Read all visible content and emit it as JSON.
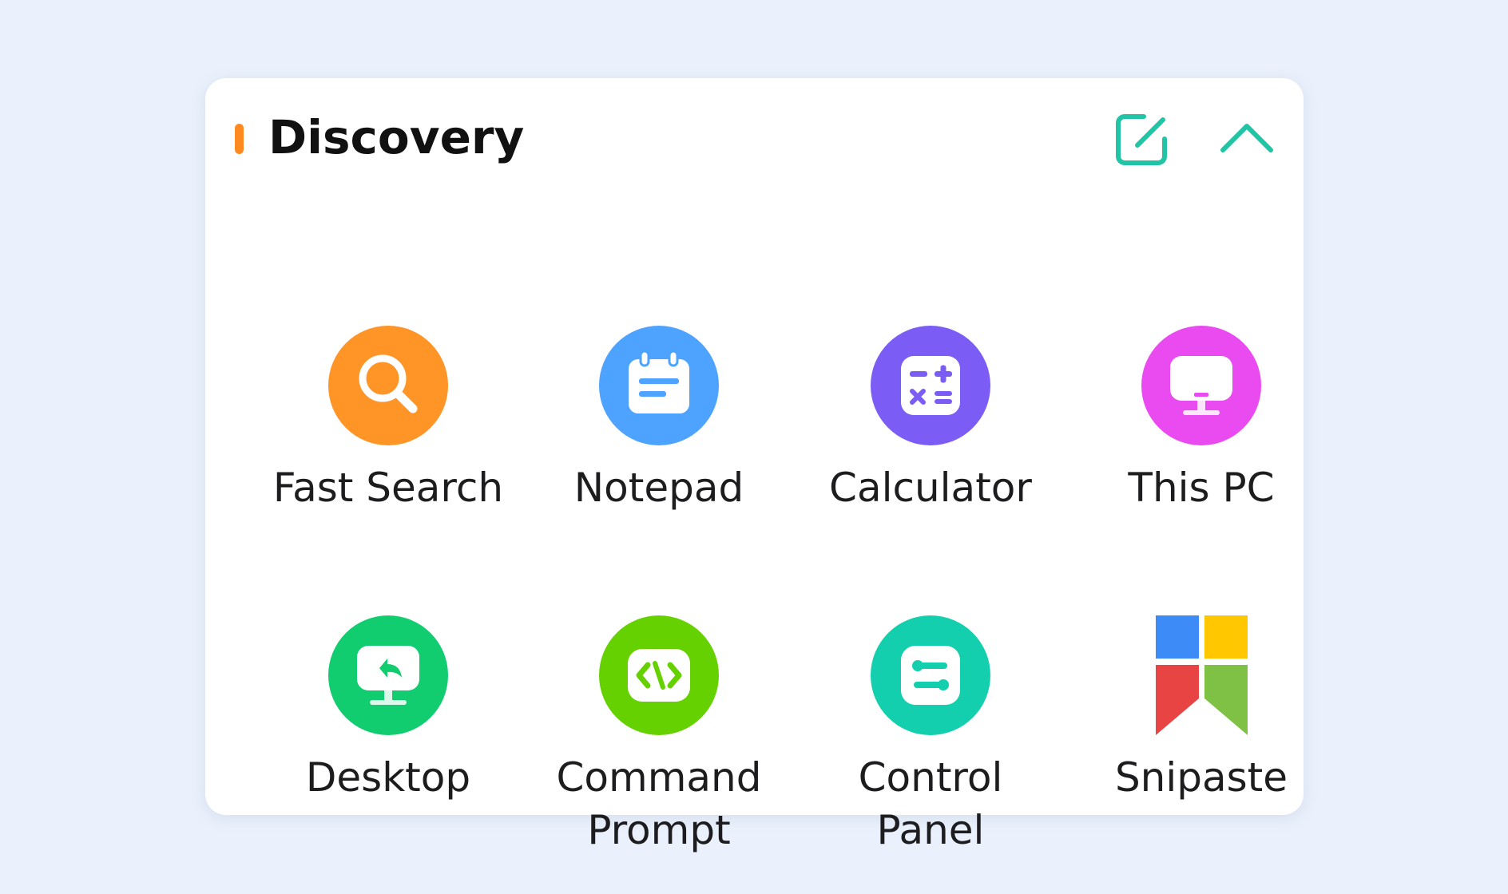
{
  "widget": {
    "title": "Discovery",
    "accent_color": "#ff8a1f",
    "edit_icon": "edit-icon",
    "collapse_icon": "chevron-up-icon",
    "icon_color": "#22c4a6"
  },
  "apps": [
    {
      "label": "Fast Search",
      "icon": "search-icon",
      "color": "#ff9427"
    },
    {
      "label": "Notepad",
      "icon": "notepad-icon",
      "color": "#4da3ff"
    },
    {
      "label": "Calculator",
      "icon": "calculator-icon",
      "color": "#7b5cf5"
    },
    {
      "label": "This PC",
      "icon": "monitor-icon",
      "color": "#e94bf0"
    },
    {
      "label": "Desktop",
      "icon": "desktop-icon",
      "color": "#12cc70"
    },
    {
      "label": "Command\nPrompt",
      "icon": "code-icon",
      "color": "#66d100"
    },
    {
      "label": "Control\nPanel",
      "icon": "settings-sliders-icon",
      "color": "#13cfae"
    },
    {
      "label": "Snipaste",
      "icon": "snipaste-logo-icon",
      "colors": [
        "#3d8bf7",
        "#ffc700",
        "#e84444",
        "#7fc144"
      ]
    }
  ]
}
